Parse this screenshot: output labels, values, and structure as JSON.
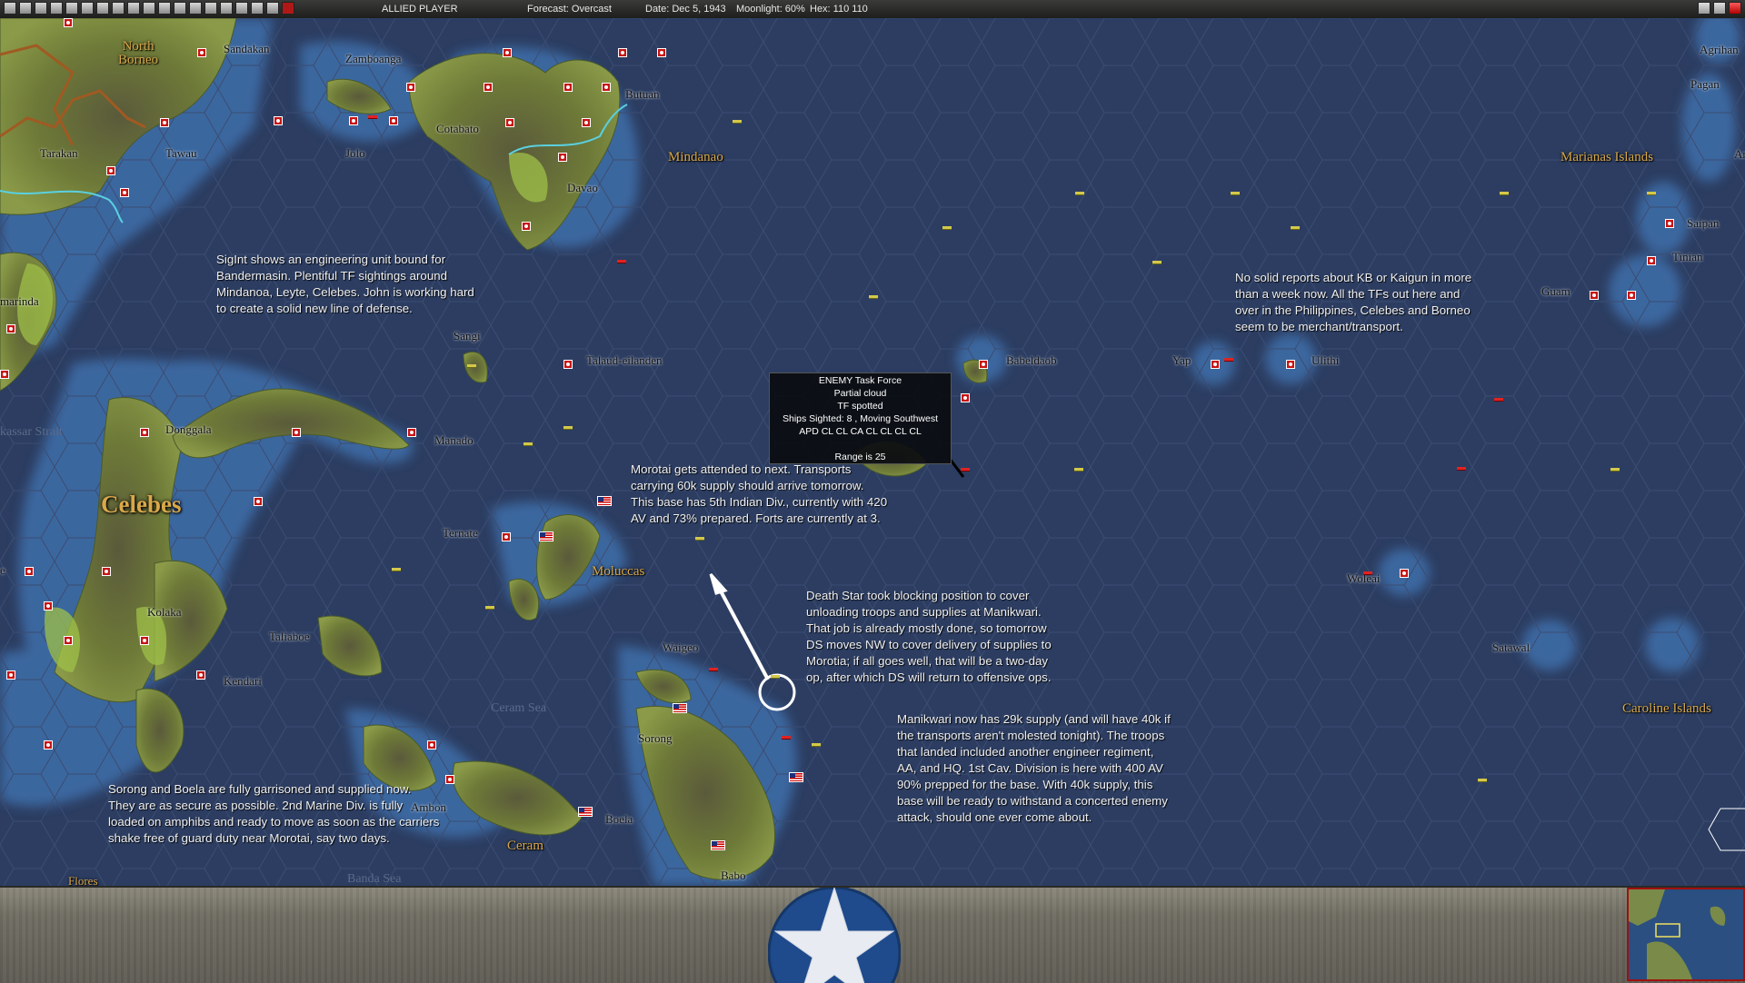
{
  "toolbar": {
    "player": "ALLIED PLAYER",
    "forecast": "Forecast: Overcast",
    "date": "Date: Dec 5, 1943",
    "moonlight": "Moonlight: 60%",
    "hex": "Hex: 110 110",
    "left_icons": [
      "turn-icon",
      "report-icon",
      "report-icon",
      "report-icon",
      "report-icon",
      "base-icon",
      "unit-icon",
      "unit-icon",
      "flag-icon",
      "unit-icon",
      "unit-icon",
      "ship-icon",
      "ship-icon",
      "globe-icon",
      "globe-icon",
      "grid-icon",
      "list-icon",
      "save-icon",
      "end-turn-icon"
    ],
    "right_icons": [
      "minimize-icon",
      "restore-icon",
      "close-icon"
    ]
  },
  "map": {
    "places": {
      "north_borneo": "North\nBorneo",
      "sandakan": "Sandakan",
      "zamboanga": "Zamboanga",
      "butuan": "Butuan",
      "tarakan": "Tarakan",
      "tawau": "Tawau",
      "jolo": "Jolo",
      "cotabato": "Cotabato",
      "davao": "Davao",
      "mindanao": "Mindanao",
      "agrihan": "Agrihan",
      "pagan": "Pagan",
      "marianas": "Marianas Islands",
      "saipan": "Saipan",
      "tinian": "Tinian",
      "guam": "Guam",
      "samarinda": "marinda",
      "sangi": "Sangi",
      "talaud": "Talaud-eilanden",
      "babeldaob": "Babeldaob",
      "yap": "Yap",
      "ulithi": "Ulithi",
      "donggala": "Donggala",
      "manado": "Manado",
      "makassar_strait": "kassar Strait",
      "celebes": "Celebes",
      "ternate": "Ternate",
      "moluccas": "Moluccas",
      "woleai": "Woleai",
      "kolaka": "Kolaka",
      "taliaboe": "Taliaboe",
      "kendari": "Kendari",
      "waigeo": "Waigeo",
      "satawal": "Satawal",
      "ceram_sea": "Ceram Sea",
      "sorong": "Sorong",
      "caroline": "Caroline Islands",
      "ambon": "Ambon",
      "boela": "Boela",
      "ceram": "Ceram",
      "babo": "Babo",
      "flores": "Flores",
      "banda_sea": "Banda Sea",
      "an": "An",
      "edge_e": "e"
    },
    "notes": {
      "sigint": "SigInt shows an engineering unit bound for\nBandermasin.  Plentiful TF sightings around\nMindanoa, Leyte, Celebes.  John is working hard\nto create a solid new line of defense.",
      "kb": "No solid reports about KB or Kaigun in more\nthan a week now.  All the TFs out here and\nover in the Philippines, Celebes and Borneo\nseem to be merchant/transport.",
      "morotai": "Morotai gets attended to next.  Transports\ncarrying 60k supply should arrive tomorrow.\nThis base has 5th Indian Div., currently with 420\nAV and 73% prepared.  Forts are currently at 3.",
      "deathstar": "Death Star took blocking position to cover\nunloading troops and supplies at Manikwari.\nThat job is already mostly done, so tomorrow\nDS moves NW to cover delivery of supplies to\nMorotia; if all goes well, that will be a two-day\nop, after which DS will return to offensive ops.",
      "manikwari": "Manikwari now has 29k supply (and will have 40k if\nthe transports aren't molested tonight).  The troops\nthat landed included another engineer regiment,\nAA, and HQ.  1st Cav. Division is here with 400 AV\n90% prepped for the base.  With 40k supply, this\nbase will be ready to withstand a concerted enemy\nattack, should one ever come about.",
      "sorong": "Sorong and Boela are fully garrisoned and supplied now.\nThey are as secure as possible.  2nd Marine Div. is fully\nloaded on amphibs and ready to move as soon as the carriers\nshake free of guard duty near Morotai, say two days."
    },
    "tooltip": {
      "line1": "ENEMY Task Force",
      "line2": "Partial cloud",
      "line3": "TF spotted",
      "line4": "Ships Sighted: 8 , Moving Southwest",
      "line5": "APD CL CL CA CL CL CL CL",
      "line6": "Range is 25"
    },
    "colors": {
      "ocean": "#2c3d61",
      "shallow": "#3f6fa8",
      "land": "#6f7e3a",
      "japanese_base": "#c81414",
      "place_gold": "#d8a84a"
    }
  },
  "bottom": {
    "roundel_icon": "us-star-roundel-icon",
    "minimap_icon": "minimap-icon"
  }
}
